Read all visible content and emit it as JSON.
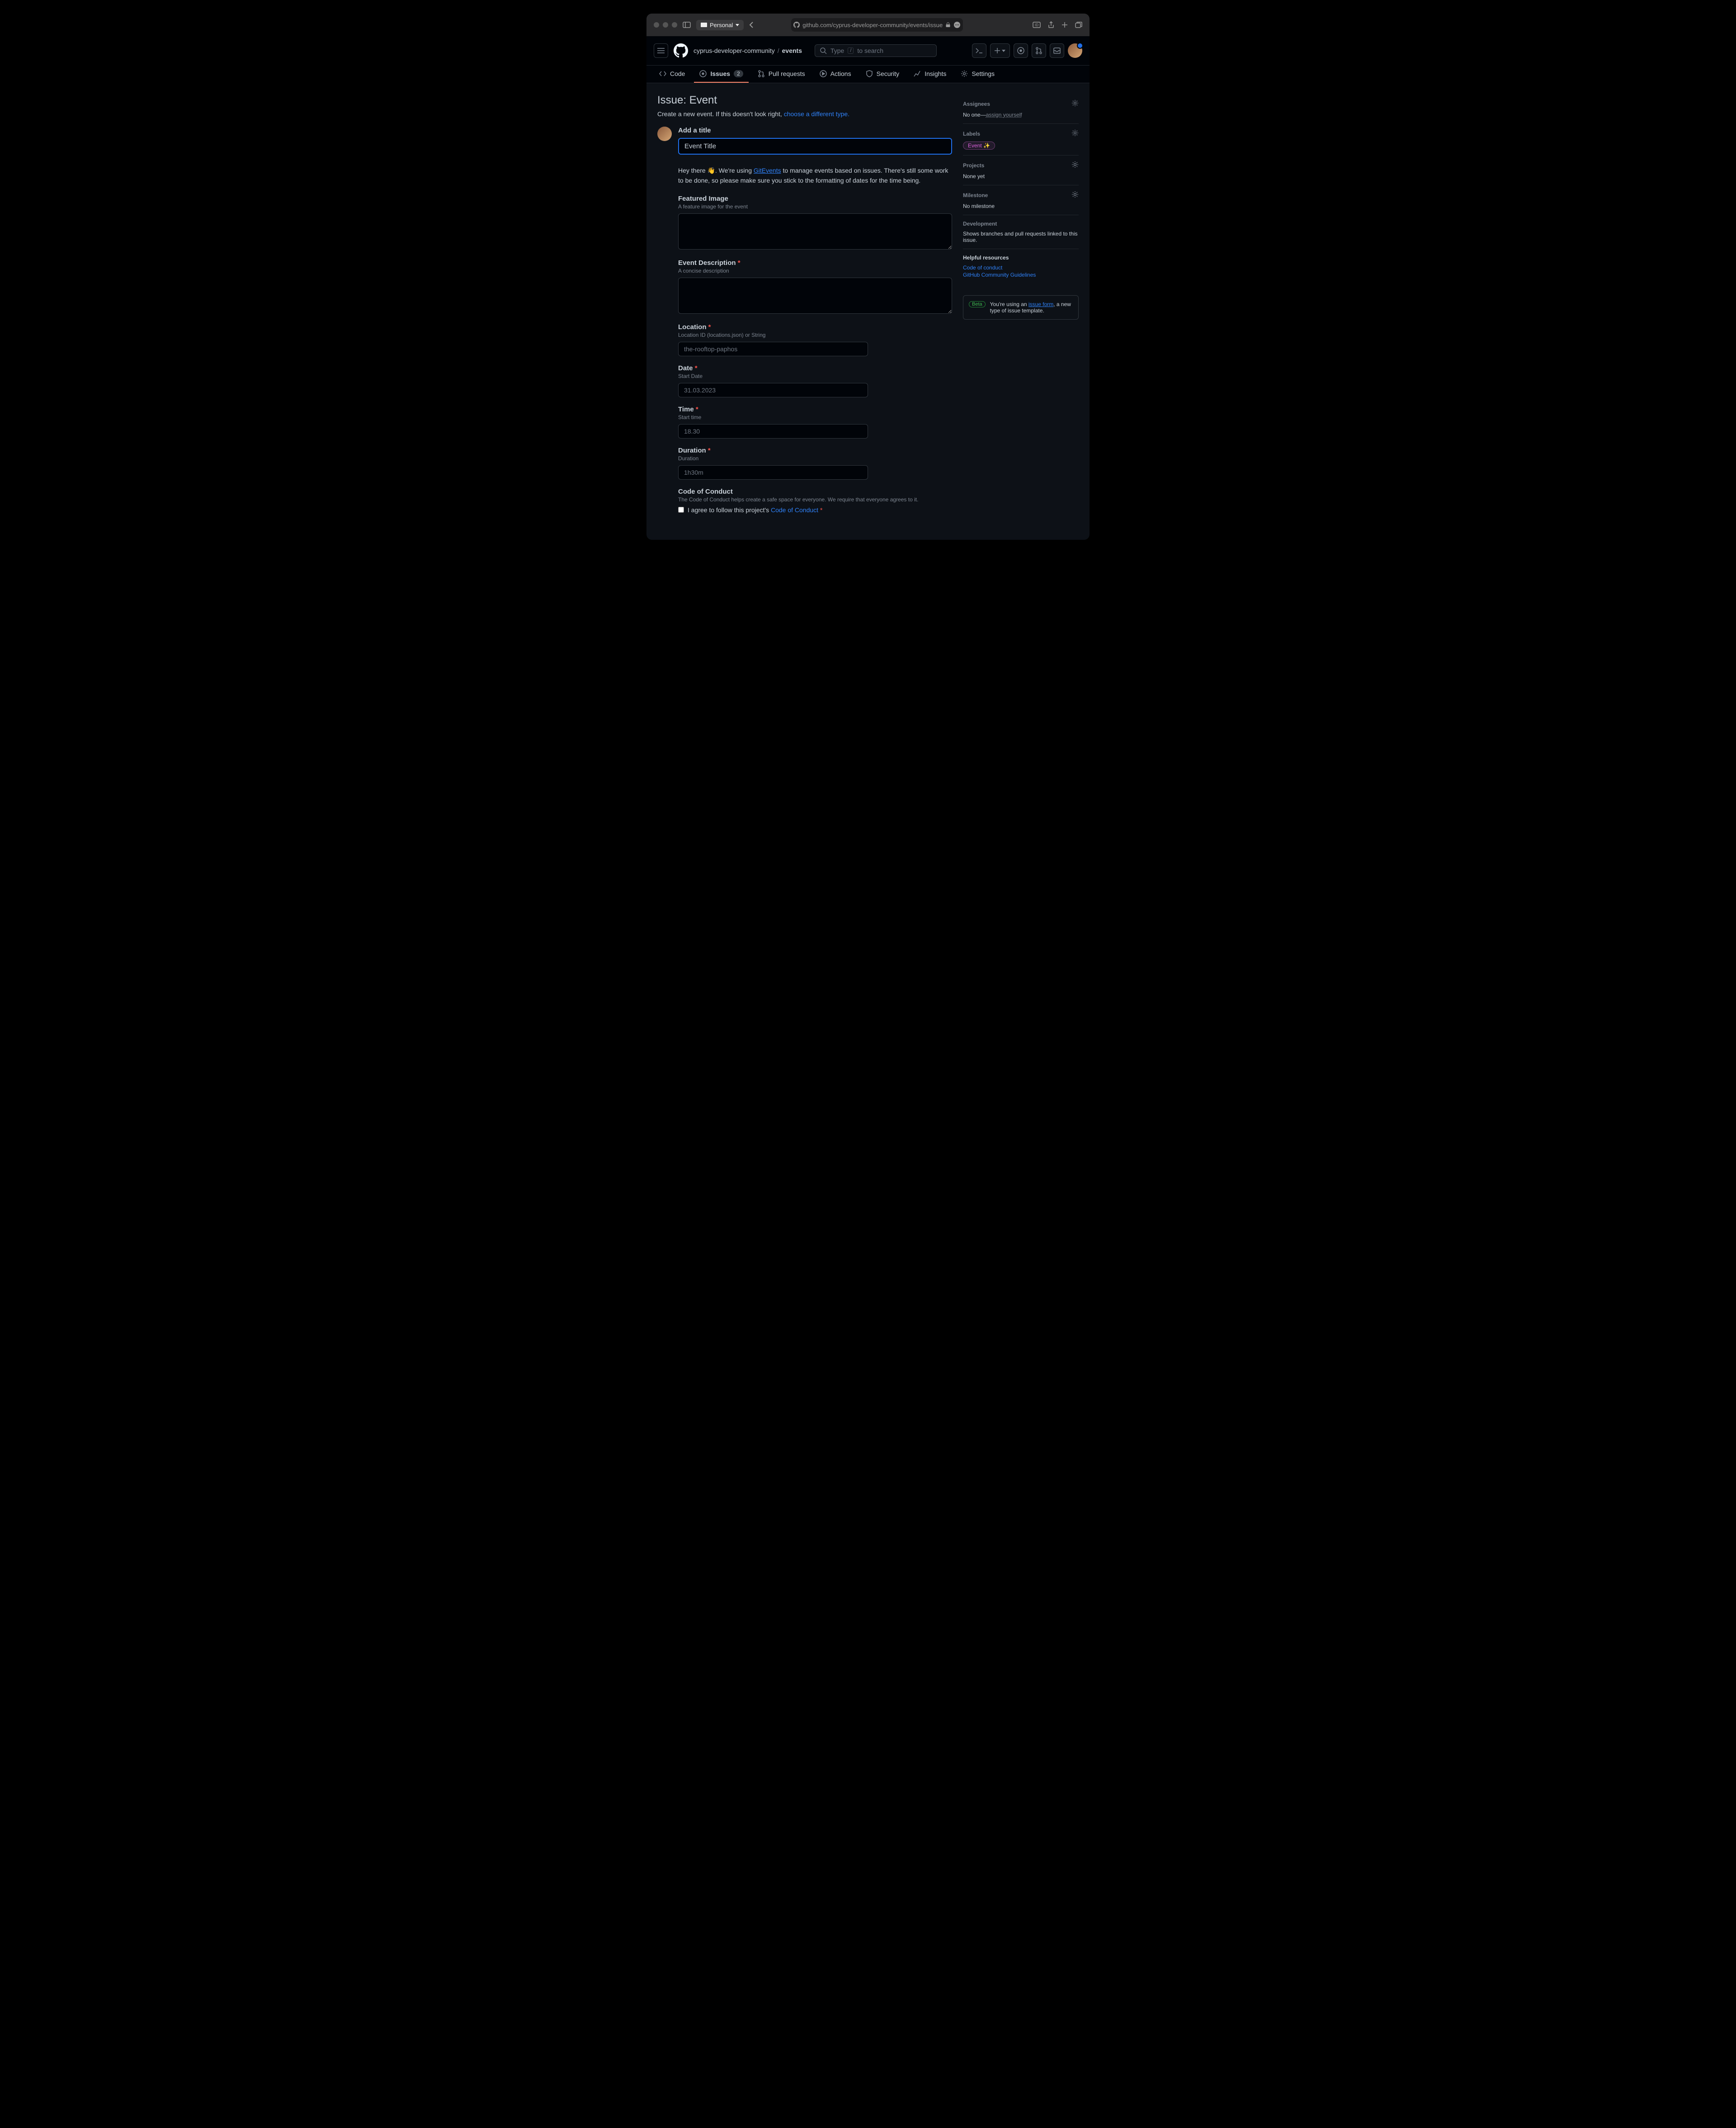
{
  "browser": {
    "profile": "Personal",
    "url": "github.com/cyprus-developer-community/events/issue"
  },
  "breadcrumb": {
    "owner": "cyprus-developer-community",
    "repo": "events"
  },
  "search": {
    "prefix": "Type",
    "key": "/",
    "suffix": "to search"
  },
  "tabs": {
    "code": "Code",
    "issues": "Issues",
    "issues_count": "2",
    "pulls": "Pull requests",
    "actions": "Actions",
    "security": "Security",
    "insights": "Insights",
    "settings": "Settings"
  },
  "page": {
    "title_prefix": "Issue: ",
    "title_value": "Event",
    "subtitle_prefix": "Create a new event. If this doesn't look right, ",
    "subtitle_link": "choose a different type."
  },
  "form": {
    "title_label": "Add a title",
    "title_value": "Event Title",
    "intro_prefix": "Hey there 👋. We're using ",
    "intro_link": "GitEvents",
    "intro_suffix": " to manage events based on issues. There's still some work to be done, so please make sure you stick to the formatting of dates for the time being.",
    "featured_image": {
      "label": "Featured Image",
      "desc": "A feature image for the event"
    },
    "description": {
      "label": "Event Description",
      "desc": "A concise description"
    },
    "location": {
      "label": "Location",
      "desc": "Location ID (locations.json) or String",
      "placeholder": "the-rooftop-paphos"
    },
    "date": {
      "label": "Date",
      "desc": "Start Date",
      "placeholder": "31.03.2023"
    },
    "time": {
      "label": "Time",
      "desc": "Start time",
      "placeholder": "18.30"
    },
    "duration": {
      "label": "Duration",
      "desc": "Duration",
      "placeholder": "1h30m"
    },
    "coc": {
      "label": "Code of Conduct",
      "desc": "The Code of Conduct helps create a safe space for everyone. We require that everyone agrees to it.",
      "checkbox_prefix": "I agree to follow this project's ",
      "checkbox_link": "Code of Conduct"
    }
  },
  "sidebar": {
    "assignees": {
      "title": "Assignees",
      "none": "No one—",
      "assign": "assign yourself"
    },
    "labels": {
      "title": "Labels",
      "pill": "Event ✨"
    },
    "projects": {
      "title": "Projects",
      "none": "None yet"
    },
    "milestone": {
      "title": "Milestone",
      "none": "No milestone"
    },
    "development": {
      "title": "Development",
      "text": "Shows branches and pull requests linked to this issue."
    },
    "resources": {
      "title": "Helpful resources",
      "coc": "Code of conduct",
      "guidelines": "GitHub Community Guidelines"
    },
    "beta": {
      "badge": "Beta",
      "prefix": "You're using an ",
      "link": "issue form",
      "suffix": ", a new type of issue template."
    }
  }
}
